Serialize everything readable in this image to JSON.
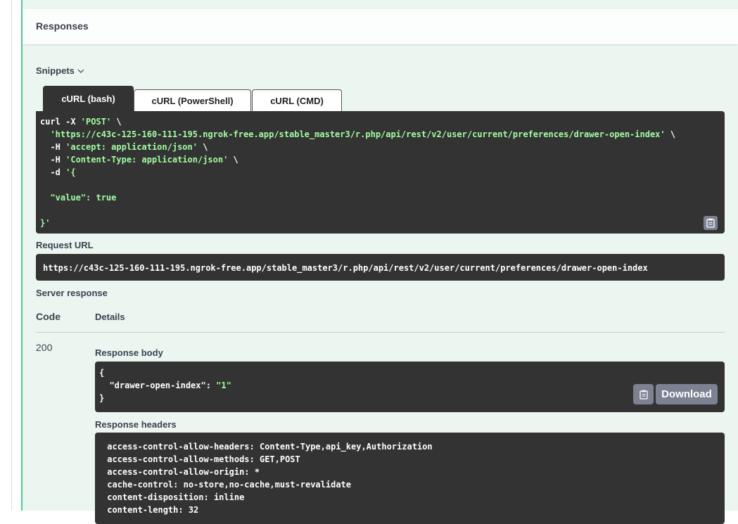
{
  "responses": {
    "title": "Responses"
  },
  "snippets": {
    "label": "Snippets",
    "tabs": [
      {
        "label": "cURL (bash)",
        "active": true
      },
      {
        "label": "cURL (PowerShell)",
        "active": false
      },
      {
        "label": "cURL (CMD)",
        "active": false
      }
    ],
    "curl_lines": {
      "l1a": "curl -X ",
      "l1b": "'POST'",
      "l1c": " \\",
      "l2a": "  ",
      "l2b": "'https://c43c-125-160-111-195.ngrok-free.app/stable_master3/r.php/api/rest/v2/user/current/preferences/drawer-open-index'",
      "l2c": " \\",
      "l3a": "  -H ",
      "l3b": "'accept: application/json'",
      "l3c": " \\",
      "l4a": "  -H ",
      "l4b": "'Content-Type: application/json'",
      "l4c": " \\",
      "l5a": "  -d ",
      "l5b": "'{",
      "l7": "  \"value\": true",
      "l9": "}'"
    }
  },
  "request_url": {
    "label": "Request URL",
    "value": "https://c43c-125-160-111-195.ngrok-free.app/stable_master3/r.php/api/rest/v2/user/current/preferences/drawer-open-index"
  },
  "server_response": {
    "label": "Server response",
    "col_code": "Code",
    "col_details": "Details",
    "code": "200",
    "body_label": "Response body",
    "body_l1": "{",
    "body_key": "  \"drawer-open-index\"",
    "body_sep": ": ",
    "body_val": "\"1\"",
    "body_l3": "}",
    "download_label": "Download",
    "headers_label": "Response headers",
    "headers": [
      " access-control-allow-headers: Content-Type,api_key,Authorization",
      " access-control-allow-methods: GET,POST",
      " access-control-allow-origin: *",
      " cache-control: no-store,no-cache,must-revalidate",
      " content-disposition: inline",
      " content-length: 32"
    ]
  },
  "colors": {
    "accent": "#49cc90",
    "panel_bg": "#ebf6f0",
    "code_bg": "#333333",
    "string": "#a2fca2"
  }
}
